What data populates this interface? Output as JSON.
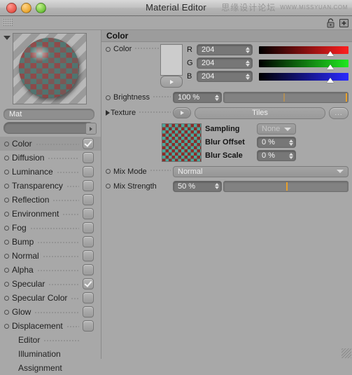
{
  "window": {
    "title": "Material Editor",
    "watermark_cn": "思缘设计论坛",
    "watermark_en": "WWW.MISSYUAN.COM"
  },
  "toolbar": {
    "lock_icon": "lock-icon",
    "add_icon": "plus-box-icon"
  },
  "sidebar": {
    "material_name": "Mat",
    "search_value": "",
    "channels": [
      {
        "label": "Color",
        "checked": true,
        "selected": true
      },
      {
        "label": "Diffusion",
        "checked": false,
        "selected": false
      },
      {
        "label": "Luminance",
        "checked": false,
        "selected": false
      },
      {
        "label": "Transparency",
        "checked": false,
        "selected": false
      },
      {
        "label": "Reflection",
        "checked": false,
        "selected": false
      },
      {
        "label": "Environment",
        "checked": false,
        "selected": false
      },
      {
        "label": "Fog",
        "checked": false,
        "selected": false
      },
      {
        "label": "Bump",
        "checked": false,
        "selected": false
      },
      {
        "label": "Normal",
        "checked": false,
        "selected": false
      },
      {
        "label": "Alpha",
        "checked": false,
        "selected": false
      },
      {
        "label": "Specular",
        "checked": true,
        "selected": false
      },
      {
        "label": "Specular Color",
        "checked": false,
        "selected": false
      },
      {
        "label": "Glow",
        "checked": false,
        "selected": false
      },
      {
        "label": "Displacement",
        "checked": false,
        "selected": false
      }
    ],
    "pages": [
      {
        "label": "Editor"
      },
      {
        "label": "Illumination"
      },
      {
        "label": "Assignment"
      }
    ]
  },
  "panel": {
    "section_title": "Color",
    "color": {
      "label": "Color",
      "swatch_hex": "#cccccc",
      "channels": [
        {
          "name": "R",
          "value": "204",
          "percent": 80
        },
        {
          "name": "G",
          "value": "204",
          "percent": 80
        },
        {
          "name": "B",
          "value": "204",
          "percent": 80
        }
      ]
    },
    "brightness": {
      "label": "Brightness",
      "value": "100 %",
      "percent": 100
    },
    "texture": {
      "label": "Texture",
      "value": "Tiles",
      "more_label": "...",
      "sampling_label": "Sampling",
      "sampling_value": "None",
      "blur_offset_label": "Blur Offset",
      "blur_offset_value": "0 %",
      "blur_scale_label": "Blur Scale",
      "blur_scale_value": "0 %"
    },
    "mix_mode": {
      "label": "Mix Mode",
      "value": "Normal"
    },
    "mix_strength": {
      "label": "Mix Strength",
      "value": "50 %",
      "percent": 50
    }
  }
}
